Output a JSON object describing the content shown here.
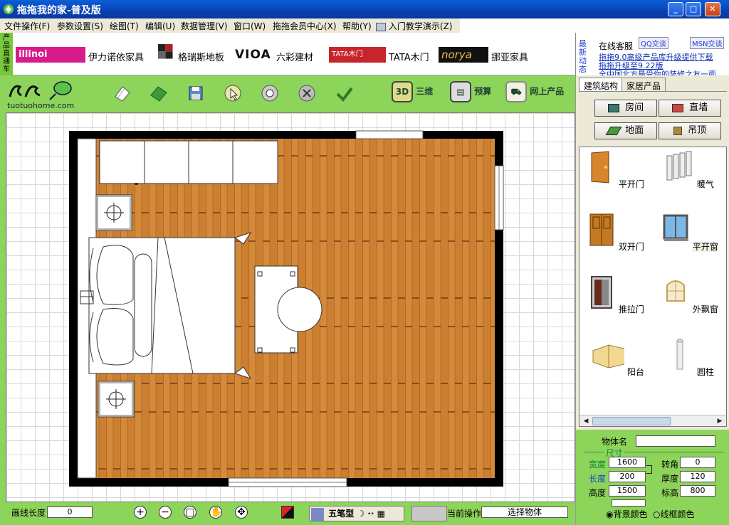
{
  "window": {
    "title": "拖拖我的家-普及版",
    "controls": [
      "_",
      "□",
      "✕"
    ]
  },
  "menu": [
    "文件操作(F)",
    "参数设置(S)",
    "绘图(T)",
    "编辑(U)",
    "数据管理(V)",
    "窗口(W)",
    "拖拖会员中心(X)",
    "帮助(Y)",
    "入门教学演示(Z)"
  ],
  "brands": {
    "tag": "产品直通车",
    "items": [
      {
        "logo": "illinoi",
        "name": "伊力诺依家具"
      },
      {
        "logo": "",
        "name": "格瑞斯地板"
      },
      {
        "logo": "VIOA",
        "name": "六彩建材"
      },
      {
        "logo": "TATA木门",
        "name": "TATA木门"
      },
      {
        "logo": "norya",
        "name": "挪亚家具"
      }
    ]
  },
  "news": {
    "tag": "最新动态",
    "online_service": "在线客服",
    "qq": "QQ交谈",
    "msn": "MSN交谈",
    "lines": [
      "拖拖9.0高级产品库升级提供下载",
      "拖拖升级至9.22版",
      "全中国北方最受你的装修之友一面"
    ]
  },
  "toolbar": {
    "logo_sub": "tuotuohome.com",
    "btn_3d_icon": "3D",
    "btn_3d": "三维",
    "btn_budget": "预算",
    "btn_online": "网上产品"
  },
  "right_panel": {
    "tabs": [
      "建筑结构",
      "家居产品"
    ],
    "buttons": [
      "房间",
      "直墙",
      "地面",
      "吊顶"
    ],
    "objects": [
      "平开门",
      "暖气",
      "双开门",
      "平开窗",
      "推拉门",
      "外飘窗",
      "阳台",
      "圆柱"
    ]
  },
  "properties": {
    "name_label": "物体名",
    "name_value": "",
    "size_label": "尺寸",
    "width_label": "宽度",
    "width_value": "1600",
    "length_label": "长度",
    "length_value": "200",
    "height_label": "高度",
    "height_value": "1500",
    "rotate_label": "转角",
    "rotate_value": "0",
    "thickness_label": "厚度",
    "thickness_value": "120",
    "elevation_label": "标高",
    "elevation_value": "800",
    "bg_color": "背景颜色",
    "frame_color": "线框颜色"
  },
  "bottom": {
    "line_len_label": "画线长度",
    "line_len_value": "0",
    "ime": "五笔型",
    "current_op_label": "当前操作",
    "current_op_value": "选择物体"
  },
  "colors": {
    "accent_green": "#8cd45a",
    "wood": "#c87a2c",
    "wall": "#000000"
  }
}
